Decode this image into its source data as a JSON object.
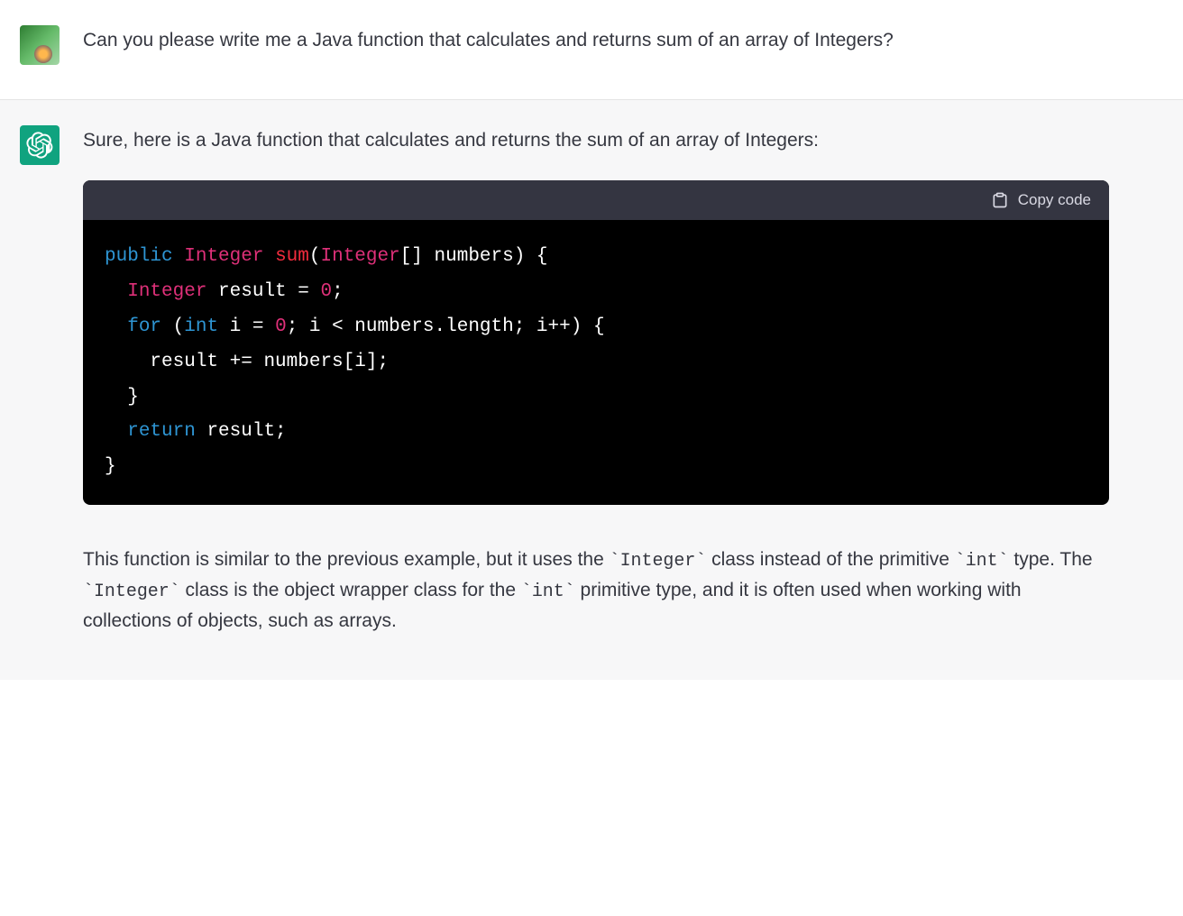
{
  "messages": {
    "user": {
      "text": "Can you please write me a Java function that calculates and returns sum of an array of Integers?"
    },
    "assistant": {
      "intro": "Sure, here is a Java function that calculates and returns the sum of an array of Integers:",
      "code": {
        "copy_label": "Copy code",
        "tokens": {
          "public": "public",
          "Integer": "Integer",
          "sum": "sum",
          "lparen": "(",
          "arr_brackets": "[] numbers) {",
          "result_decl": " result = ",
          "zero1": "0",
          "semi": ";",
          "for": "for",
          "lfor": " (",
          "int": "int",
          "i_decl": " i = ",
          "zero2": "0",
          "cond": "; i < numbers.length; i++) {",
          "body": "result += numbers[i];",
          "rbrace1": "}",
          "return": "return",
          "return_val": " result;",
          "rbrace2": "}"
        }
      },
      "explanation": {
        "p1_a": "This function is similar to the previous example, but it uses the ",
        "p1_code1": "`Integer`",
        "p1_b": " class instead of the primitive ",
        "p1_code2": "`int`",
        "p1_c": " type. The ",
        "p1_code3": "`Integer`",
        "p1_d": " class is the object wrapper class for the ",
        "p1_code4": "`int`",
        "p1_e": " primitive type, and it is often used when working with collections of objects, such as arrays."
      }
    }
  }
}
